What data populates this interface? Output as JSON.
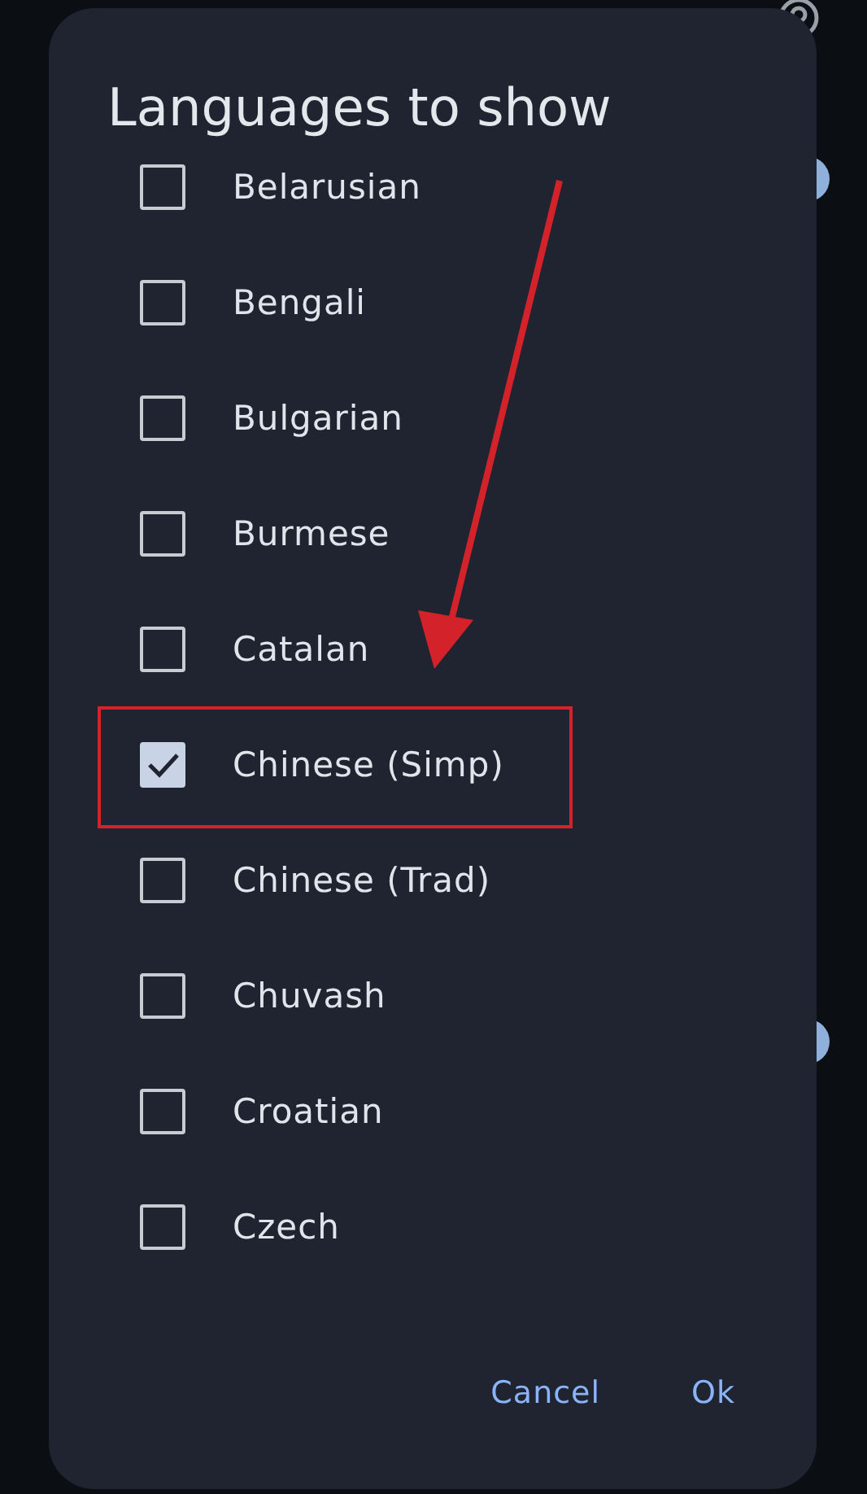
{
  "background": {
    "toggles": [
      {
        "on": true
      },
      {
        "on": true
      }
    ]
  },
  "dialog": {
    "title": "Languages to show",
    "options": [
      {
        "label": "Belarusian",
        "checked": false
      },
      {
        "label": "Bengali",
        "checked": false
      },
      {
        "label": "Bulgarian",
        "checked": false
      },
      {
        "label": "Burmese",
        "checked": false
      },
      {
        "label": "Catalan",
        "checked": false
      },
      {
        "label": "Chinese (Simp)",
        "checked": true
      },
      {
        "label": "Chinese (Trad)",
        "checked": false
      },
      {
        "label": "Chuvash",
        "checked": false
      },
      {
        "label": "Croatian",
        "checked": false
      },
      {
        "label": "Czech",
        "checked": false
      }
    ],
    "buttons": [
      "Cancel",
      "Ok"
    ]
  }
}
